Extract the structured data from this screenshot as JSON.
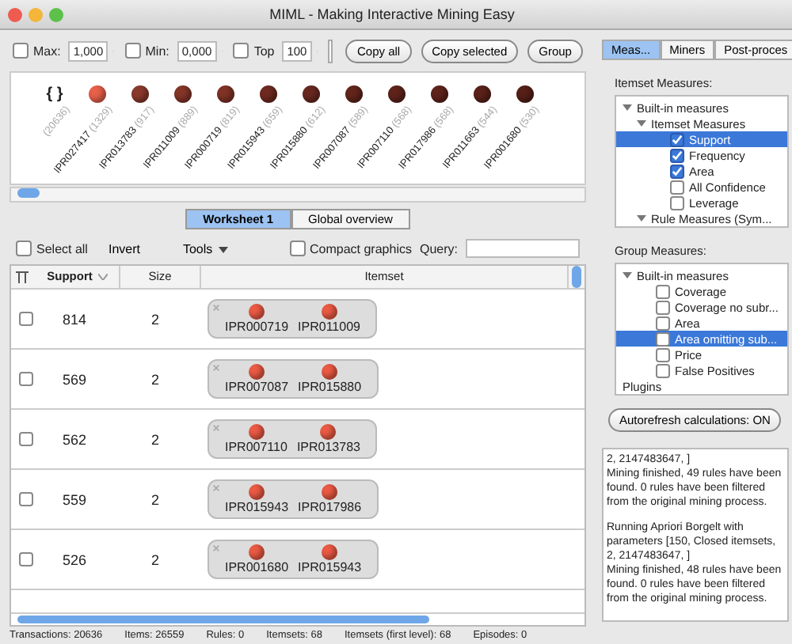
{
  "window": {
    "title": "MIML - Making Interactive Mining Easy"
  },
  "toolbar": {
    "fields": [
      {
        "label": "Max:",
        "checked": false,
        "value": "1,000"
      },
      {
        "label": "Min:",
        "checked": false,
        "value": "0,000"
      },
      {
        "label": "Top",
        "checked": false,
        "value": "100"
      }
    ],
    "buttons": [
      "Copy all",
      "Copy selected",
      "Group"
    ]
  },
  "items_strip": {
    "all": {
      "glyph": "{ }",
      "count": "(20636)"
    },
    "items": [
      {
        "name": "IPR027417",
        "count": "(1329)",
        "color": "#e8604a"
      },
      {
        "name": "IPR013783",
        "count": "(917)",
        "color": "#8a3a2c"
      },
      {
        "name": "IPR011009",
        "count": "(889)",
        "color": "#843528"
      },
      {
        "name": "IPR000719",
        "count": "(819)",
        "color": "#803226"
      },
      {
        "name": "IPR015943",
        "count": "(659)",
        "color": "#6e2a20"
      },
      {
        "name": "IPR015880",
        "count": "(612)",
        "color": "#682820"
      },
      {
        "name": "IPR007087",
        "count": "(589)",
        "color": "#62251c"
      },
      {
        "name": "IPR007110",
        "count": "(568)",
        "color": "#5e231b"
      },
      {
        "name": "IPR017986",
        "count": "(568)",
        "color": "#5e231b"
      },
      {
        "name": "IPR011663",
        "count": "(544)",
        "color": "#5a2119"
      },
      {
        "name": "IPR001680",
        "count": "(530)",
        "color": "#561f18"
      }
    ]
  },
  "view_tabs": [
    {
      "label": "Worksheet 1",
      "selected": true
    },
    {
      "label": "Global overview",
      "selected": false
    }
  ],
  "table_toolbar": {
    "select_all": {
      "label": "Select all",
      "checked": false
    },
    "invert": "Invert",
    "tools": "Tools",
    "compact": {
      "label": "Compact graphics",
      "checked": false
    },
    "query_label": "Query:"
  },
  "table": {
    "columns": [
      "Support",
      "Size",
      "Itemset"
    ],
    "rows": [
      {
        "checked": false,
        "support": "814",
        "size": "2",
        "items": [
          "IPR000719",
          "IPR011009"
        ]
      },
      {
        "checked": false,
        "support": "569",
        "size": "2",
        "items": [
          "IPR007087",
          "IPR015880"
        ]
      },
      {
        "checked": false,
        "support": "562",
        "size": "2",
        "items": [
          "IPR007110",
          "IPR013783"
        ]
      },
      {
        "checked": false,
        "support": "559",
        "size": "2",
        "items": [
          "IPR015943",
          "IPR017986"
        ]
      },
      {
        "checked": false,
        "support": "526",
        "size": "2",
        "items": [
          "IPR001680",
          "IPR015943"
        ]
      }
    ]
  },
  "side_tabs": [
    {
      "label": "Meas...",
      "selected": true
    },
    {
      "label": "Miners",
      "selected": false
    },
    {
      "label": "Post-proces",
      "selected": false
    }
  ],
  "itemset_measures": {
    "label": "Itemset Measures:",
    "tree": [
      {
        "label": "Built-in measures",
        "expanded": true,
        "children": [
          {
            "label": "Itemset Measures",
            "expanded": true,
            "children": [
              {
                "label": "Support",
                "checked": true,
                "selected": true
              },
              {
                "label": "Frequency",
                "checked": true,
                "selected": false
              },
              {
                "label": "Area",
                "checked": true,
                "selected": false
              },
              {
                "label": "All Confidence",
                "checked": false,
                "selected": false
              },
              {
                "label": "Leverage",
                "checked": false,
                "selected": false
              }
            ]
          },
          {
            "label": "Rule Measures (Sym...",
            "expanded": true
          }
        ]
      }
    ]
  },
  "group_measures": {
    "label": "Group Measures:",
    "tree": [
      {
        "label": "Built-in measures",
        "expanded": true,
        "children": [
          {
            "label": "Coverage",
            "checked": false,
            "selected": false
          },
          {
            "label": "Coverage no subr...",
            "checked": false,
            "selected": false
          },
          {
            "label": "Area",
            "checked": false,
            "selected": false
          },
          {
            "label": "Area omitting sub...",
            "checked": false,
            "selected": true
          },
          {
            "label": "Price",
            "checked": false,
            "selected": false
          },
          {
            "label": "False Positives",
            "checked": false,
            "selected": false
          }
        ]
      },
      {
        "label": "Plugins"
      }
    ]
  },
  "autorefresh": "Autorefresh calculations: ON",
  "log": [
    [
      "2, 2147483647, ]",
      "Mining finished, 49 rules have been found. 0 rules have been filtered from the original mining process."
    ],
    [
      "Running Apriori Borgelt with parameters [150, Closed itemsets, 2, 2147483647, ]",
      "Mining finished, 48 rules have been found. 0 rules have been filtered from the original mining process."
    ]
  ],
  "status_bar": [
    "Transactions: 20636",
    "Items: 26559",
    "Rules: 0",
    "Itemsets: 68",
    "Itemsets (first level): 68",
    "Episodes: 0"
  ]
}
